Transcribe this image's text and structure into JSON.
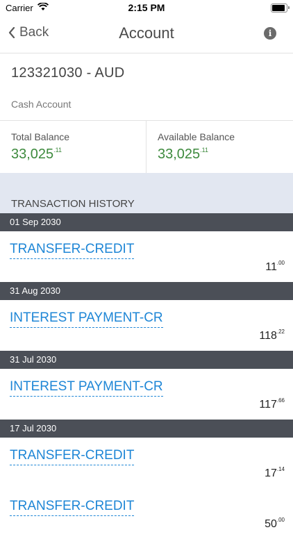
{
  "status_bar": {
    "carrier": "Carrier",
    "time": "2:15 PM"
  },
  "nav": {
    "back_label": "Back",
    "title": "Account",
    "info_glyph": "i"
  },
  "account": {
    "id_currency": "123321030 - AUD",
    "type": "Cash Account"
  },
  "balances": {
    "total": {
      "label": "Total Balance",
      "whole": "33,025",
      "cents": ".11"
    },
    "available": {
      "label": "Available Balance",
      "whole": "33,025",
      "cents": ".11"
    }
  },
  "history": {
    "title": "TRANSACTION HISTORY",
    "groups": [
      {
        "date": "01 Sep 2030",
        "items": [
          {
            "name": "TRANSFER-CREDIT",
            "whole": "11",
            "cents": ".00"
          }
        ]
      },
      {
        "date": "31 Aug 2030",
        "items": [
          {
            "name": "INTEREST PAYMENT-CR",
            "whole": "118",
            "cents": ".22"
          }
        ]
      },
      {
        "date": "31 Jul 2030",
        "items": [
          {
            "name": "INTEREST PAYMENT-CR",
            "whole": "117",
            "cents": ".66"
          }
        ]
      },
      {
        "date": "17 Jul 2030",
        "items": [
          {
            "name": "TRANSFER-CREDIT",
            "whole": "17",
            "cents": ".14"
          },
          {
            "name": "TRANSFER-CREDIT",
            "whole": "50",
            "cents": ".00"
          }
        ]
      }
    ]
  },
  "colors": {
    "link": "#1e86d6",
    "positive": "#3d8a3d",
    "date_header": "#4b4f57",
    "history_band": "#e2e7f1"
  }
}
